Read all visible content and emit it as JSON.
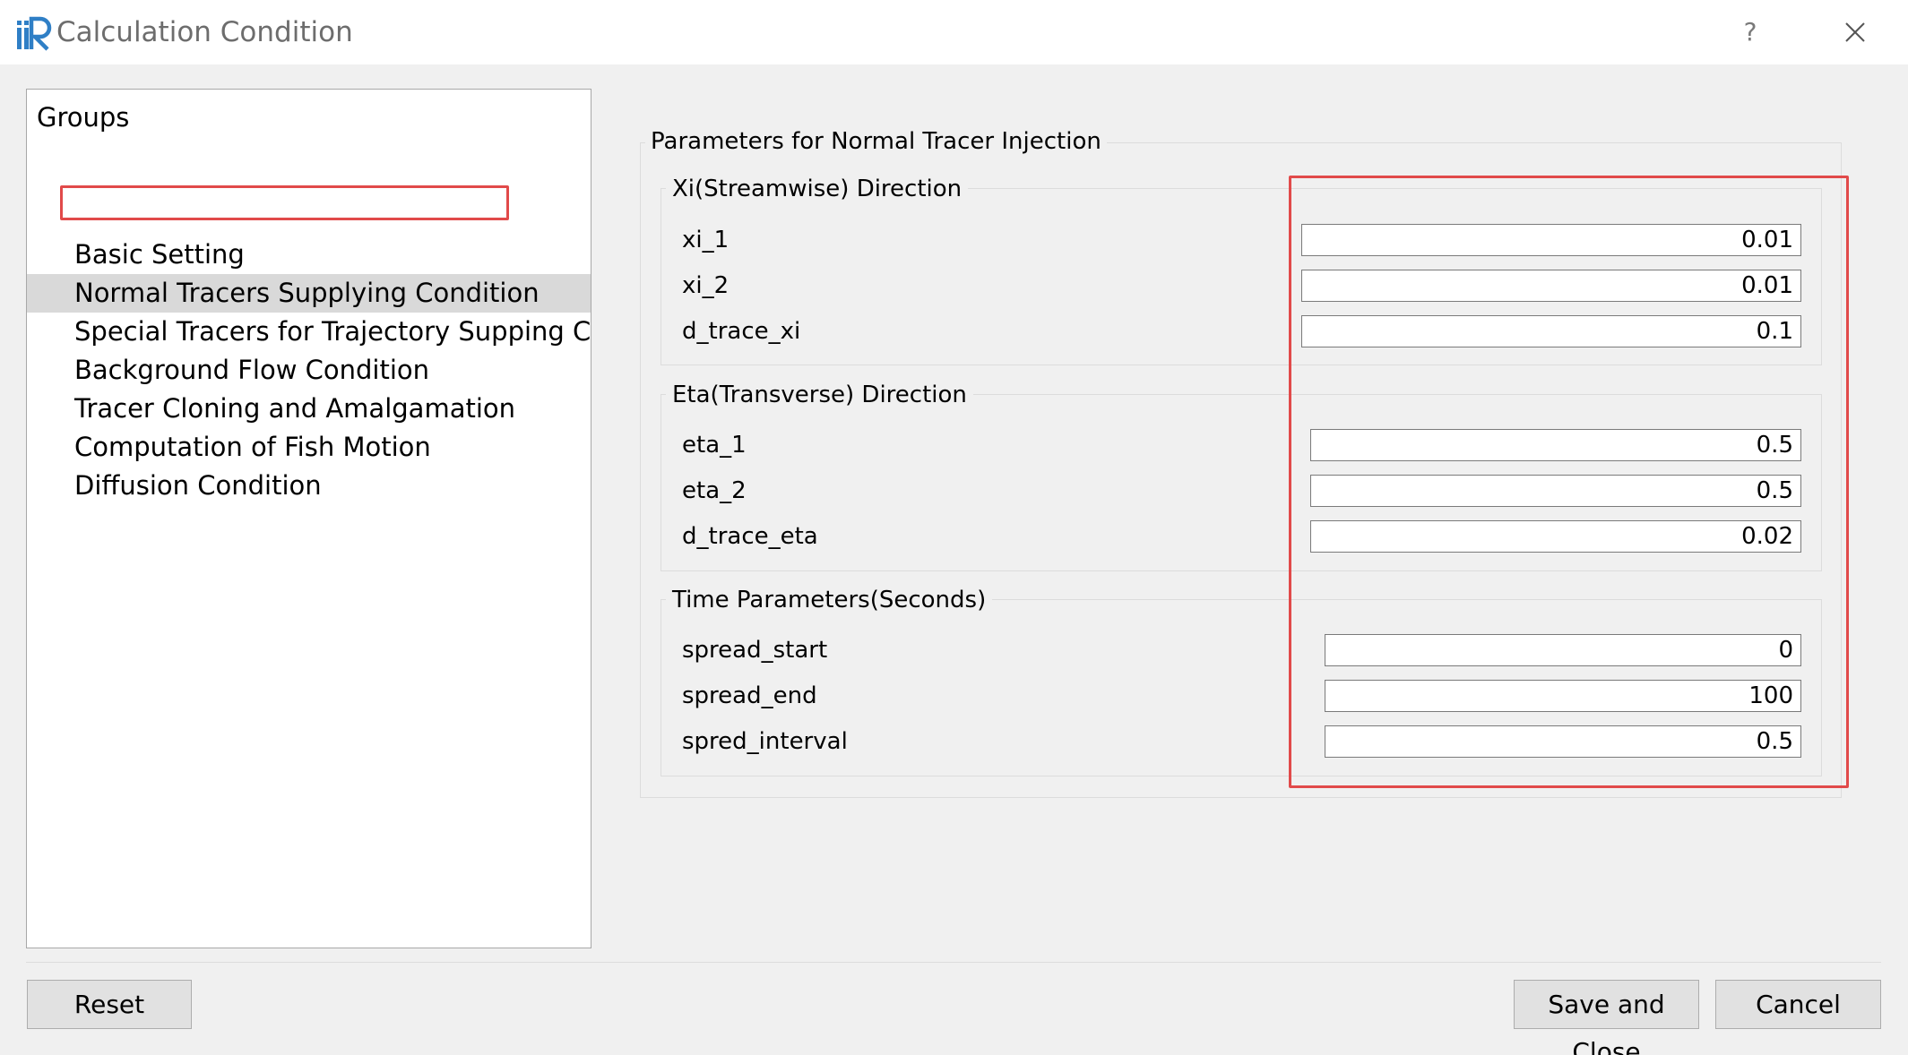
{
  "window": {
    "title": "Calculation Condition",
    "help_label": "?"
  },
  "groups": {
    "header": "Groups",
    "items": [
      {
        "label": "Basic Setting"
      },
      {
        "label": "Normal Tracers Supplying Condition"
      },
      {
        "label": "Special Tracers for Trajectory Supping Co..."
      },
      {
        "label": "Background Flow Condition"
      },
      {
        "label": "Tracer Cloning and Amalgamation"
      },
      {
        "label": "Computation of Fish Motion"
      },
      {
        "label": "Diffusion Condition"
      }
    ],
    "selected": "Normal Tracers Supplying Condition"
  },
  "main": {
    "title": "Parameters for Normal Tracer Injection",
    "sections": [
      {
        "title": "Xi(Streamwise) Direction",
        "fields": [
          {
            "label": "xi_1",
            "value": "0.01"
          },
          {
            "label": "xi_2",
            "value": "0.01"
          },
          {
            "label": "d_trace_xi",
            "value": "0.1"
          }
        ]
      },
      {
        "title": "Eta(Transverse) Direction",
        "fields": [
          {
            "label": "eta_1",
            "value": "0.5"
          },
          {
            "label": "eta_2",
            "value": "0.5"
          },
          {
            "label": "d_trace_eta",
            "value": "0.02"
          }
        ]
      },
      {
        "title": "Time Parameters(Seconds)",
        "fields": [
          {
            "label": "spread_start",
            "value": "0"
          },
          {
            "label": "spread_end",
            "value": "100"
          },
          {
            "label": "spred_interval",
            "value": "0.5"
          }
        ]
      }
    ]
  },
  "buttons": {
    "reset": "Reset",
    "save_close": "Save and Close",
    "cancel": "Cancel"
  },
  "colors": {
    "highlight": "#e14a4a",
    "selection": "#d9d9d9",
    "icon_blue": "#2f7fc6"
  },
  "icons": {
    "app": "iric-logo-icon",
    "close": "close-icon"
  }
}
